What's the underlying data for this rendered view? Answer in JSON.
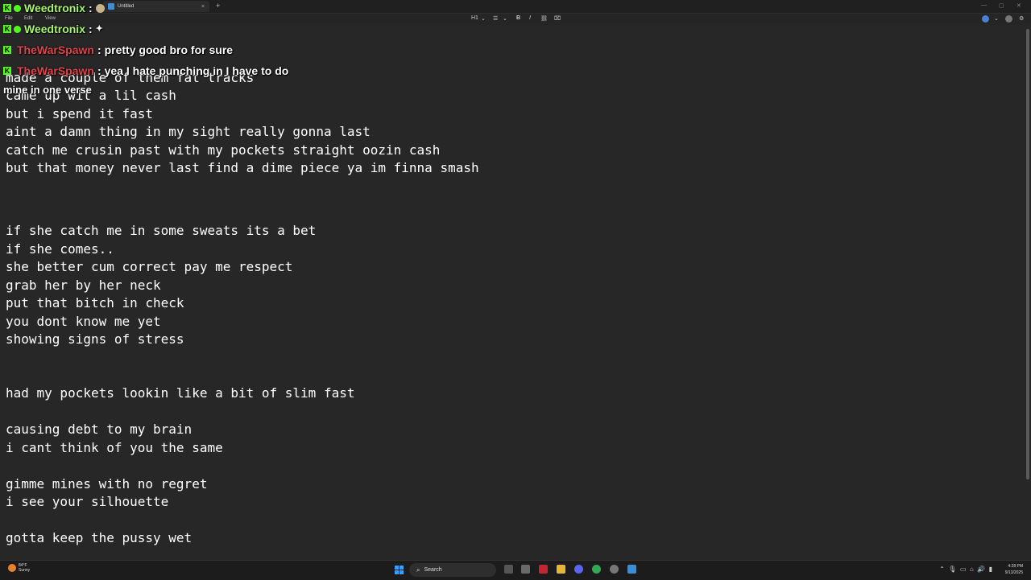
{
  "window": {
    "tab_title": "Untitled",
    "tab_close": "×",
    "new_tab": "+",
    "min_icon": "—",
    "max_icon": "▢",
    "close_icon": "✕"
  },
  "menu": {
    "file": "File",
    "edit": "Edit",
    "view": "View",
    "heading_select": "H1",
    "bold": "B",
    "italic": "I"
  },
  "editor_lines": [
    {
      "text": "made a couple of them fat tracks",
      "y": 0
    },
    {
      "text": "came up wit a lil cash",
      "y": 1
    },
    {
      "text": "but i spend it fast",
      "y": 2
    },
    {
      "text": "aint a damn thing in my sight really gonna last",
      "y": 3
    },
    {
      "text": "catch me crusin past with my pockets straight oozin cash",
      "y": 4
    },
    {
      "text": "but that money never last find a dime piece ya im finna smash",
      "y": 5
    },
    {
      "text": "if she catch me in some sweats its a bet",
      "y": 6
    },
    {
      "text": "if she comes..",
      "y": 7
    },
    {
      "text": "she better cum correct pay me respect",
      "y": 8
    },
    {
      "text": "grab her by her neck",
      "y": 9
    },
    {
      "text": "put that bitch in check",
      "y": 10
    },
    {
      "text": "you dont know me yet",
      "y": 11
    },
    {
      "text": "showing signs of stress",
      "y": 12
    },
    {
      "text": "had my pockets lookin like a bit of slim fast",
      "y": 13
    },
    {
      "text": "causing debt to my brain",
      "y": 14
    },
    {
      "text": "i cant think of you the same",
      "y": 15
    },
    {
      "text": "gimme mines with no regret",
      "y": 16
    },
    {
      "text": "i see your silhouette",
      "y": 17
    },
    {
      "text": "gotta keep the pussy wet",
      "y": 18
    }
  ],
  "chat": {
    "messages": [
      {
        "user": "Weedtronix",
        "sep": ":",
        "text": ""
      },
      {
        "user": "Weedtronix",
        "sep": ":",
        "text": ""
      },
      {
        "user": "TheWarSpawn",
        "sep": ":",
        "text": "pretty good bro for sure"
      },
      {
        "user": "TheWarSpawn",
        "sep": ":",
        "text": "yea I hate punching in I have to do"
      }
    ],
    "wrap_text": "mine in one verse",
    "kick_glyph": "K"
  },
  "taskbar": {
    "weather_temp": "84°F",
    "weather_desc": "Sunny",
    "search_label": "Search",
    "time": "4:28 PM",
    "date": "9/13/2025"
  },
  "colors": {
    "background": "#272727",
    "kick_green": "#53fc18",
    "user_green": "#a6f56a",
    "user_red": "#e0434b",
    "spell_red": "#d23a3a"
  }
}
